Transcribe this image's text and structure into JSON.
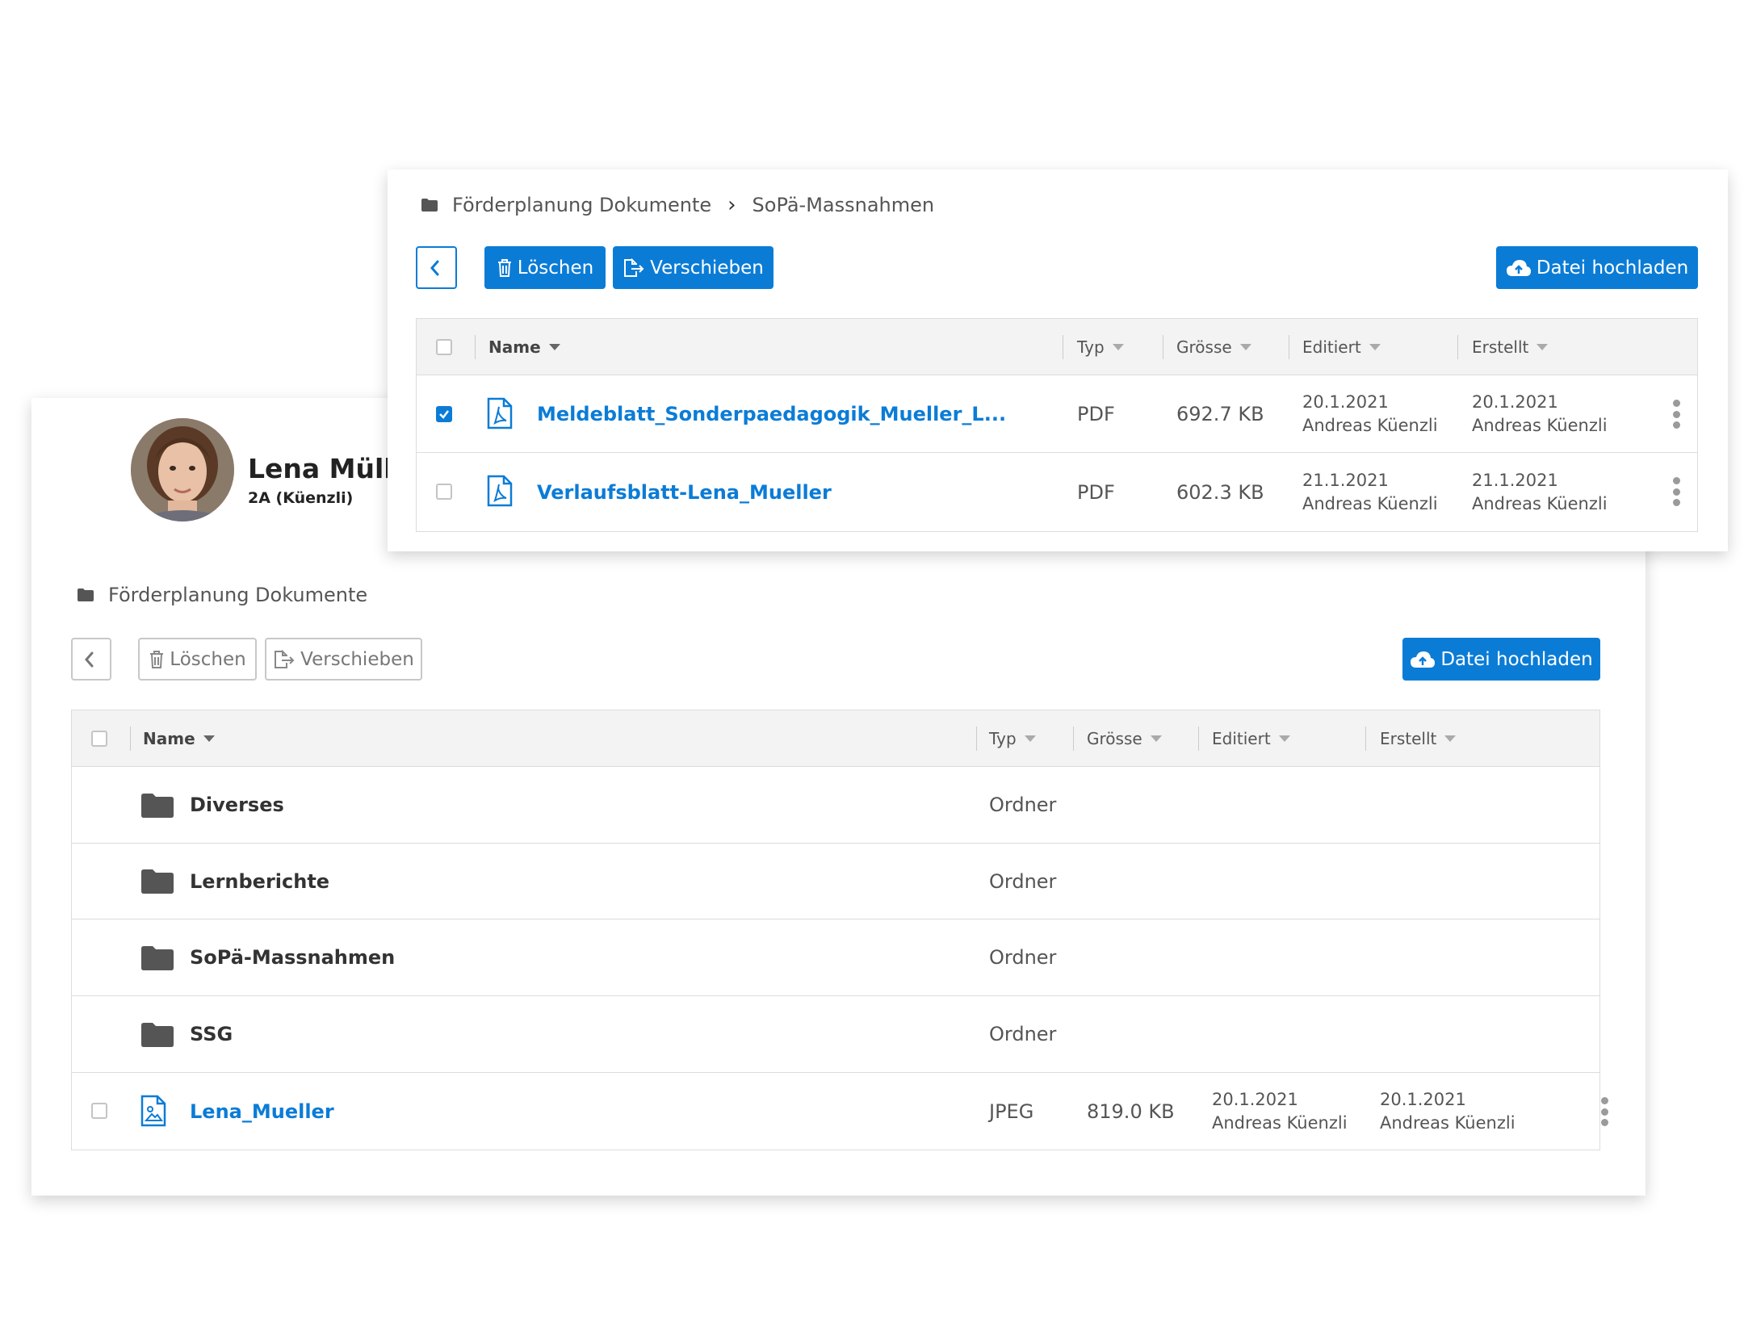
{
  "profile": {
    "name": "Lena Müller",
    "class": "2A (Küenzli)"
  },
  "back_panel": {
    "breadcrumb": [
      "Förderplanung Dokumente"
    ],
    "toolbar": {
      "delete_label": "Löschen",
      "move_label": "Verschieben",
      "upload_label": "Datei hochladen"
    },
    "columns": {
      "name": "Name",
      "type": "Typ",
      "size": "Grösse",
      "edited": "Editiert",
      "created": "Erstellt"
    },
    "rows": [
      {
        "name": "Diverses",
        "type": "Ordner"
      },
      {
        "name": "Lernberichte",
        "type": "Ordner"
      },
      {
        "name": "SoPä-Massnahmen",
        "type": "Ordner"
      },
      {
        "name": "SSG",
        "type": "Ordner"
      },
      {
        "name": "Lena_Mueller",
        "type": "JPEG",
        "size": "819.0 KB",
        "edited_date": "20.1.2021",
        "edited_by": "Andreas Küenzli",
        "created_date": "20.1.2021",
        "created_by": "Andreas Küenzli"
      }
    ]
  },
  "front_panel": {
    "breadcrumb": [
      "Förderplanung Dokumente",
      "SoPä-Massnahmen"
    ],
    "toolbar": {
      "delete_label": "Löschen",
      "move_label": "Verschieben",
      "upload_label": "Datei hochladen"
    },
    "columns": {
      "name": "Name",
      "type": "Typ",
      "size": "Grösse",
      "edited": "Editiert",
      "created": "Erstellt"
    },
    "rows": [
      {
        "name": "Meldeblatt_Sonderpaedagogik_Mueller_L...",
        "type": "PDF",
        "size": "692.7 KB",
        "edited_date": "20.1.2021",
        "edited_by": "Andreas Küenzli",
        "created_date": "20.1.2021",
        "created_by": "Andreas Küenzli",
        "checked": true
      },
      {
        "name": "Verlaufsblatt-Lena_Mueller",
        "type": "PDF",
        "size": "602.3 KB",
        "edited_date": "21.1.2021",
        "edited_by": "Andreas Küenzli",
        "created_date": "21.1.2021",
        "created_by": "Andreas Küenzli",
        "checked": false
      }
    ]
  },
  "colors": {
    "primary": "#0b7cd6",
    "header_bg": "#f3f3f3",
    "folder_icon": "#555555"
  },
  "icons": {
    "folder": "folder-icon",
    "pdf": "pdf-file-icon",
    "image": "image-file-icon",
    "trash": "trash-icon",
    "move": "move-file-icon",
    "upload": "cloud-upload-icon",
    "back": "chevron-left-icon",
    "more": "kebab-menu-icon"
  }
}
